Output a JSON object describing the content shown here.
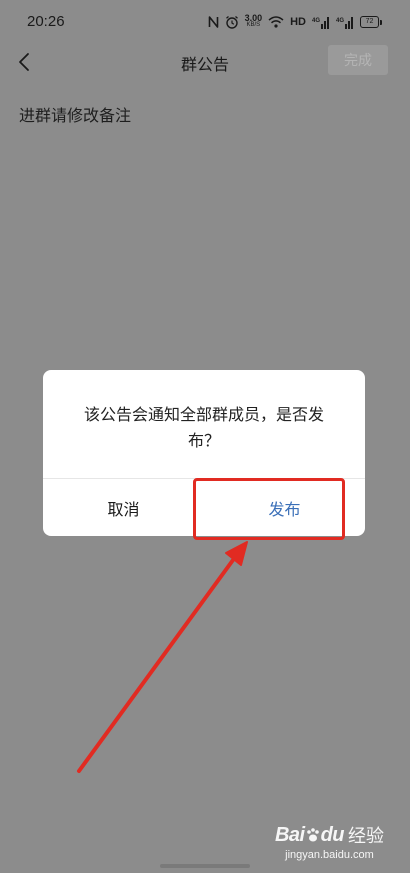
{
  "status_bar": {
    "time": "20:26",
    "net_speed_value": "3.00",
    "net_speed_unit": "KB/S",
    "hd_label": "HD",
    "signal1_label": "4G",
    "signal2_label": "4G",
    "battery_level": "72",
    "icons": [
      "nfc-icon",
      "alarm-icon",
      "wifi-icon",
      "signal-icon",
      "battery-icon"
    ]
  },
  "nav": {
    "back_icon": "chevron-left-icon",
    "title": "群公告",
    "done_label": "完成"
  },
  "editor": {
    "content": "进群请修改备注"
  },
  "dialog": {
    "message": "该公告会通知全部群成员，是否发布？",
    "cancel_label": "取消",
    "publish_label": "发布"
  },
  "annotation": {
    "color": "#e12b22",
    "target": "publish-button"
  },
  "watermark": {
    "brand": "Bai",
    "brand_tail": "du",
    "product": "经验",
    "url": "jingyan.baidu.com"
  },
  "colors": {
    "overlay_background": "#8c8c8c",
    "dialog_background": "#ffffff",
    "publish_text": "#3a6fb8",
    "cancel_text": "#1a1a1a"
  }
}
